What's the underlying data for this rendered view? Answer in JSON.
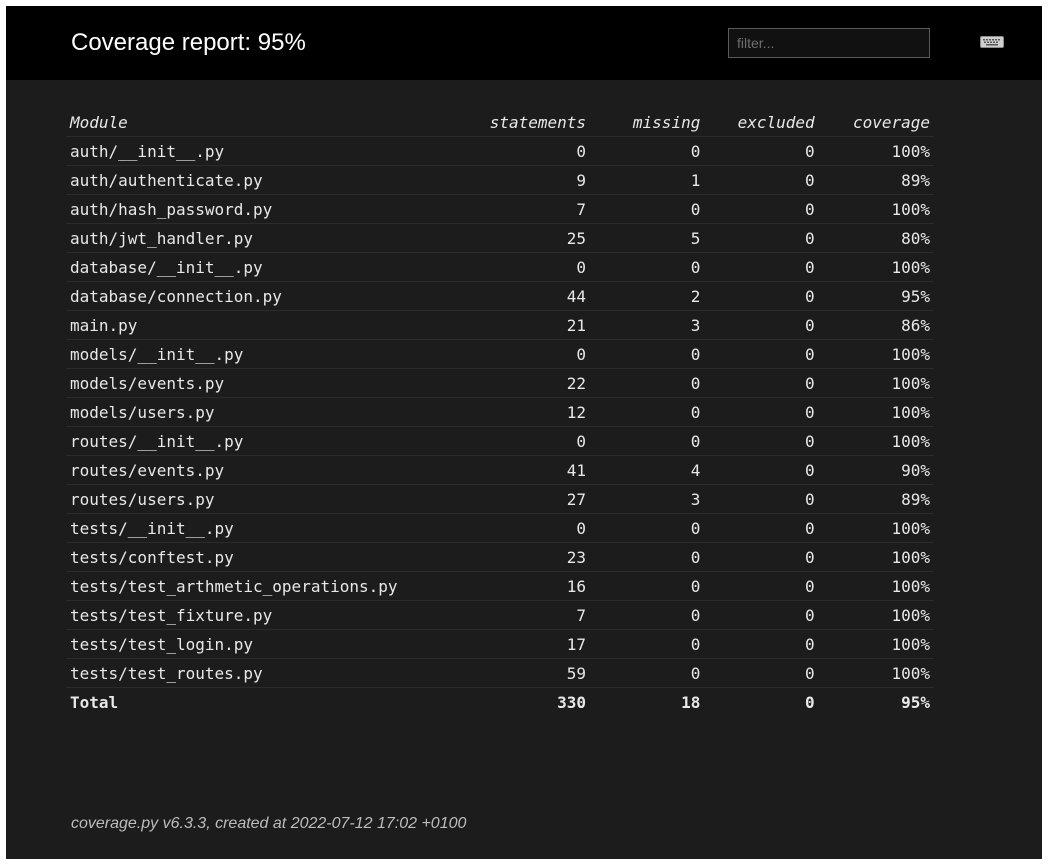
{
  "header": {
    "title": "Coverage report: 95%",
    "filter_placeholder": "filter...",
    "keyboard_icon": "keyboard-icon"
  },
  "table": {
    "columns": [
      "Module",
      "statements",
      "missing",
      "excluded",
      "coverage"
    ],
    "rows": [
      {
        "module": "auth/__init__.py",
        "statements": "0",
        "missing": "0",
        "excluded": "0",
        "coverage": "100%"
      },
      {
        "module": "auth/authenticate.py",
        "statements": "9",
        "missing": "1",
        "excluded": "0",
        "coverage": "89%"
      },
      {
        "module": "auth/hash_password.py",
        "statements": "7",
        "missing": "0",
        "excluded": "0",
        "coverage": "100%"
      },
      {
        "module": "auth/jwt_handler.py",
        "statements": "25",
        "missing": "5",
        "excluded": "0",
        "coverage": "80%"
      },
      {
        "module": "database/__init__.py",
        "statements": "0",
        "missing": "0",
        "excluded": "0",
        "coverage": "100%"
      },
      {
        "module": "database/connection.py",
        "statements": "44",
        "missing": "2",
        "excluded": "0",
        "coverage": "95%"
      },
      {
        "module": "main.py",
        "statements": "21",
        "missing": "3",
        "excluded": "0",
        "coverage": "86%"
      },
      {
        "module": "models/__init__.py",
        "statements": "0",
        "missing": "0",
        "excluded": "0",
        "coverage": "100%"
      },
      {
        "module": "models/events.py",
        "statements": "22",
        "missing": "0",
        "excluded": "0",
        "coverage": "100%"
      },
      {
        "module": "models/users.py",
        "statements": "12",
        "missing": "0",
        "excluded": "0",
        "coverage": "100%"
      },
      {
        "module": "routes/__init__.py",
        "statements": "0",
        "missing": "0",
        "excluded": "0",
        "coverage": "100%"
      },
      {
        "module": "routes/events.py",
        "statements": "41",
        "missing": "4",
        "excluded": "0",
        "coverage": "90%"
      },
      {
        "module": "routes/users.py",
        "statements": "27",
        "missing": "3",
        "excluded": "0",
        "coverage": "89%"
      },
      {
        "module": "tests/__init__.py",
        "statements": "0",
        "missing": "0",
        "excluded": "0",
        "coverage": "100%"
      },
      {
        "module": "tests/conftest.py",
        "statements": "23",
        "missing": "0",
        "excluded": "0",
        "coverage": "100%"
      },
      {
        "module": "tests/test_arthmetic_operations.py",
        "statements": "16",
        "missing": "0",
        "excluded": "0",
        "coverage": "100%"
      },
      {
        "module": "tests/test_fixture.py",
        "statements": "7",
        "missing": "0",
        "excluded": "0",
        "coverage": "100%"
      },
      {
        "module": "tests/test_login.py",
        "statements": "17",
        "missing": "0",
        "excluded": "0",
        "coverage": "100%"
      },
      {
        "module": "tests/test_routes.py",
        "statements": "59",
        "missing": "0",
        "excluded": "0",
        "coverage": "100%"
      }
    ],
    "total": {
      "module": "Total",
      "statements": "330",
      "missing": "18",
      "excluded": "0",
      "coverage": "95%"
    }
  },
  "footer": {
    "text": "coverage.py v6.3.3, created at 2022-07-12 17:02 +0100"
  },
  "colors": {
    "header_bg": "#000000",
    "page_bg": "#1c1c1c",
    "text": "#e8e8e8"
  }
}
